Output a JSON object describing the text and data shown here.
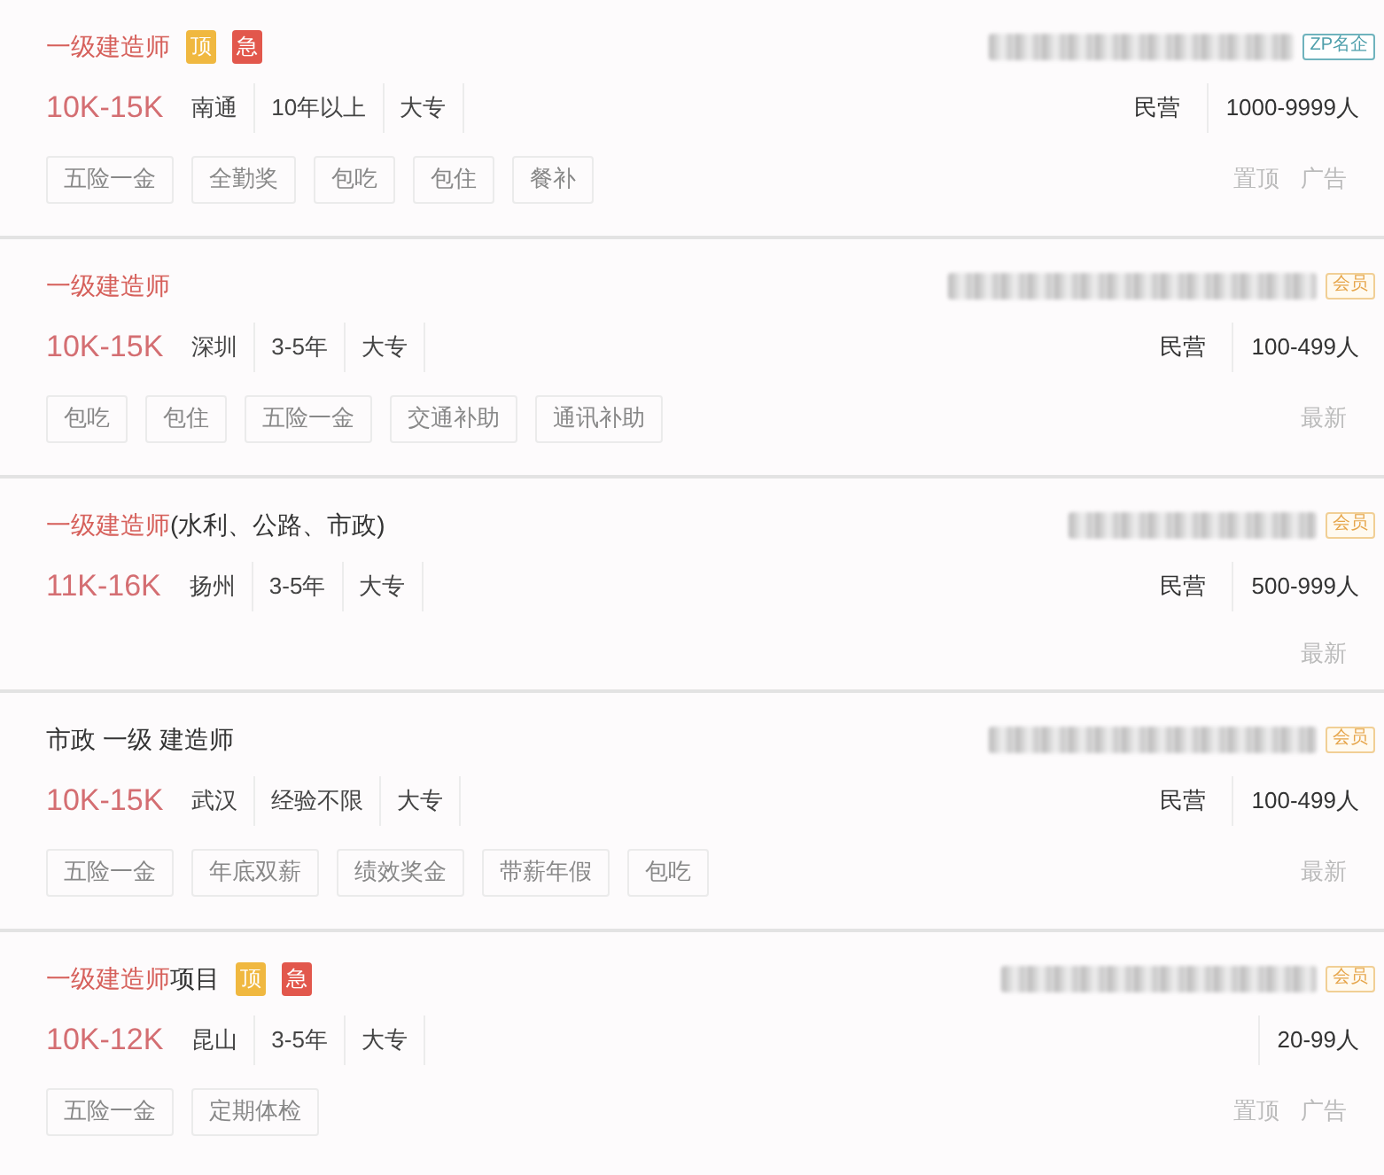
{
  "jobs": [
    {
      "title_parts": [
        {
          "text": "一级建造师",
          "highlight": true
        }
      ],
      "badges": [
        {
          "kind": "top",
          "label": "顶"
        },
        {
          "kind": "urgent",
          "label": "急"
        }
      ],
      "salary": "10K-15K",
      "meta": [
        "南通",
        "10年以上",
        "大专"
      ],
      "tags": [
        "五险一金",
        "全勤奖",
        "包吃",
        "包住",
        "餐补"
      ],
      "company": {
        "badge": {
          "kind": "famous",
          "label": "ZP名企"
        },
        "type": "民营",
        "size": "1000-9999人"
      },
      "flags": [
        "置顶",
        "广告"
      ]
    },
    {
      "title_parts": [
        {
          "text": "一级建造师",
          "highlight": true
        }
      ],
      "salary": "10K-15K",
      "meta": [
        "深圳",
        "3-5年",
        "大专"
      ],
      "tags": [
        "包吃",
        "包住",
        "五险一金",
        "交通补助",
        "通讯补助"
      ],
      "company": {
        "badge": {
          "kind": "member",
          "label": "会员"
        },
        "type": "民营",
        "size": "100-499人"
      },
      "flags": [
        "最新"
      ]
    },
    {
      "title_parts": [
        {
          "text": "一级建造师",
          "highlight": true
        },
        {
          "text": "(水利、公路、市政)",
          "highlight": false
        }
      ],
      "salary": "11K-16K",
      "meta": [
        "扬州",
        "3-5年",
        "大专"
      ],
      "company": {
        "badge": {
          "kind": "member",
          "label": "会员"
        },
        "type": "民营",
        "size": "500-999人"
      },
      "flags": [
        "最新"
      ]
    },
    {
      "title_parts": [
        {
          "text": "市政 一级 建造师",
          "highlight": false
        }
      ],
      "salary": "10K-15K",
      "meta": [
        "武汉",
        "经验不限",
        "大专"
      ],
      "tags": [
        "五险一金",
        "年底双薪",
        "绩效奖金",
        "带薪年假",
        "包吃"
      ],
      "company": {
        "badge": {
          "kind": "member",
          "label": "会员"
        },
        "type": "民营",
        "size": "100-499人"
      },
      "flags": [
        "最新"
      ]
    },
    {
      "title_parts": [
        {
          "text": "一级建造师",
          "highlight": true
        },
        {
          "text": "项目",
          "highlight": false
        }
      ],
      "badges": [
        {
          "kind": "top",
          "label": "顶"
        },
        {
          "kind": "urgent",
          "label": "急"
        }
      ],
      "salary": "10K-12K",
      "meta": [
        "昆山",
        "3-5年",
        "大专"
      ],
      "tags": [
        "五险一金",
        "定期体检"
      ],
      "company": {
        "badge": {
          "kind": "member",
          "label": "会员"
        },
        "size": "20-99人"
      },
      "flags": [
        "置顶",
        "广告"
      ]
    }
  ]
}
